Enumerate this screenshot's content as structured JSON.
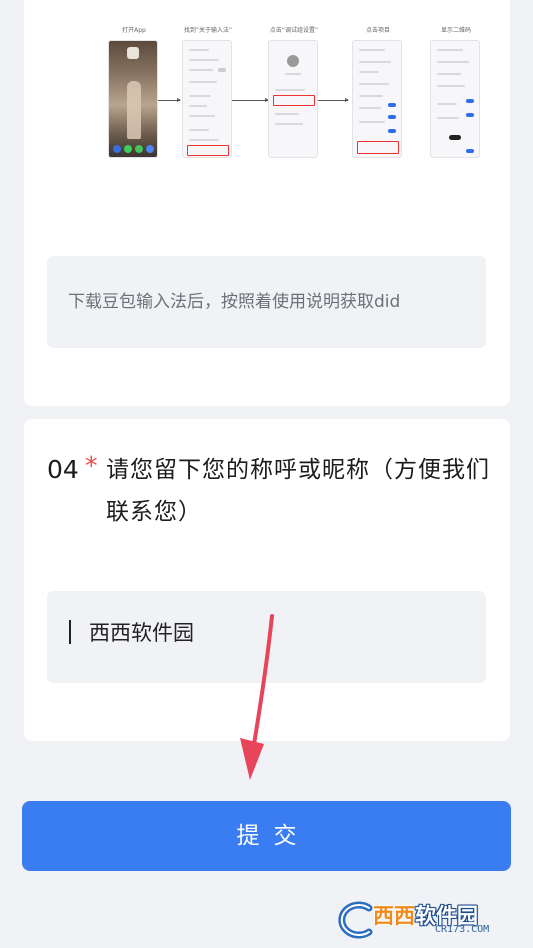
{
  "guide": {
    "steps": [
      {
        "title": "打开App"
      },
      {
        "title": "找到“关于输入法”"
      },
      {
        "title": "点击“调试组设置”"
      },
      {
        "title": "点击项目"
      },
      {
        "title": "显示二维码"
      }
    ]
  },
  "did_field": {
    "placeholder": "下载豆包输入法后，按照着使用说明获取did"
  },
  "question4": {
    "number": "04",
    "required_mark": "*",
    "text": "请您留下您的称呼或昵称（方便我们联系您）"
  },
  "name_field": {
    "value": "西西软件园"
  },
  "submit": {
    "label": "提交"
  },
  "watermark": {
    "text_part1": "西西",
    "text_part2": "软件园",
    "domain": "CR173.COM"
  },
  "colors": {
    "accent": "#3a7cf2",
    "required": "#e84a4a",
    "annotation_arrow": "#e8455a"
  }
}
